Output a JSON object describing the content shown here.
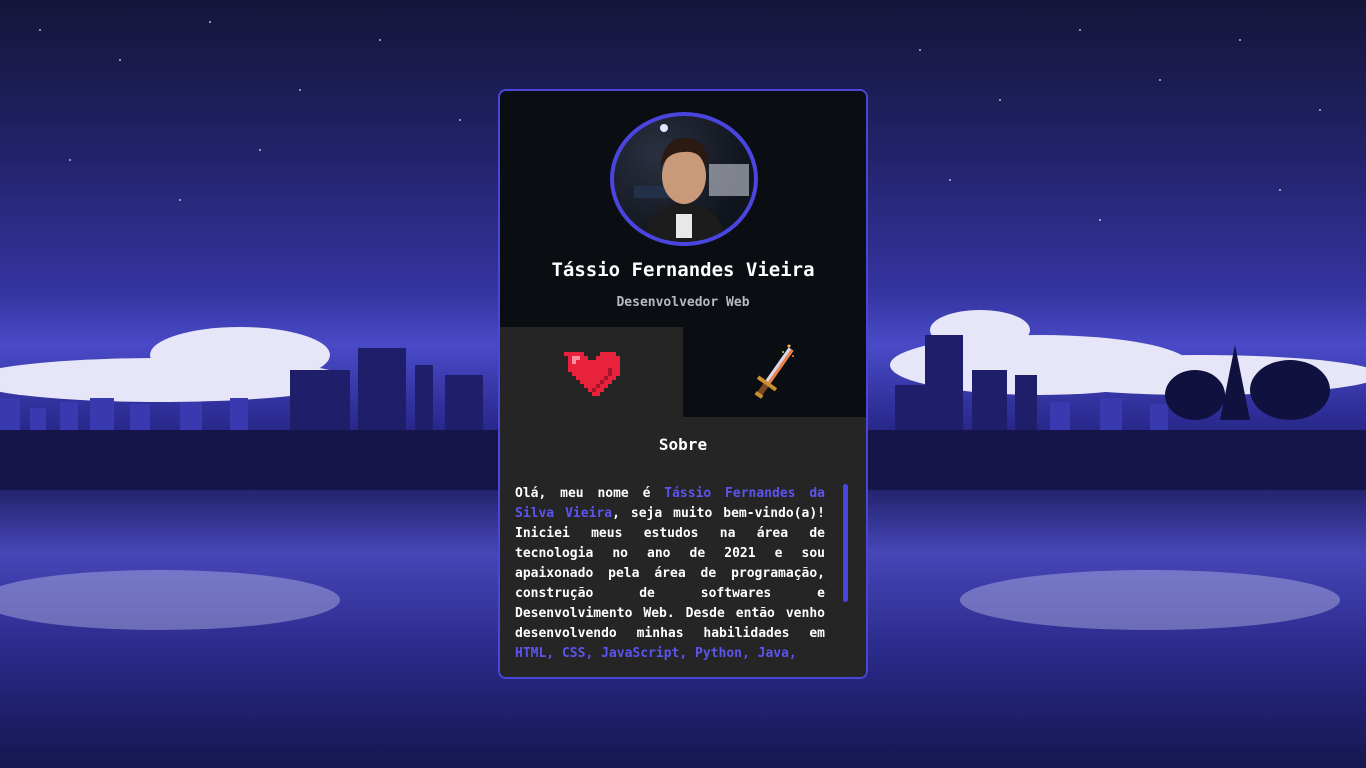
{
  "profile": {
    "name": "Tássio Fernandes Vieira",
    "role": "Desenvolvedor Web"
  },
  "tabs": [
    {
      "icon": "heart-icon",
      "active": true
    },
    {
      "icon": "sword-icon",
      "active": false
    }
  ],
  "about": {
    "title": "Sobre",
    "p1": "Olá, meu nome é ",
    "name_highlight": "Tássio Fernandes da Silva Vieira",
    "p2": ", seja muito bem-vindo(a)! Iniciei meus estudos na área de tecnologia no ano de 2021 e sou apaixonado pela área de programação, construção de softwares e Desenvolvimento Web. Desde então venho desenvolvendo minhas habilidades em ",
    "skills_highlight": "HTML, CSS, JavaScript, Python, Java,"
  },
  "colors": {
    "accent": "#4b45e0",
    "card_bg": "#0a0d12",
    "panel_bg": "#252525",
    "highlight": "#5b55f0"
  }
}
